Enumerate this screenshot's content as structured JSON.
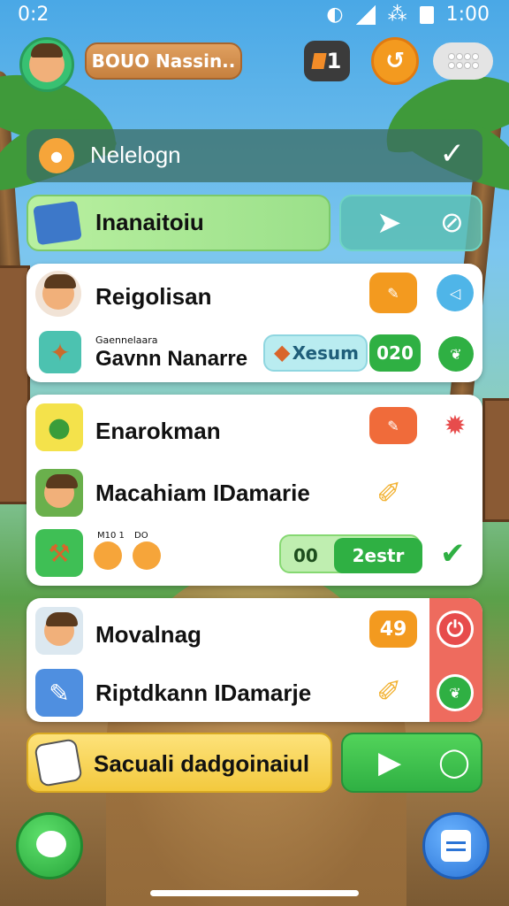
{
  "status_bar": {
    "time": "0:2",
    "clock": "1:00"
  },
  "top_bar": {
    "player_name": "BOUO Nassin..",
    "currency_value": "1"
  },
  "rows": {
    "header_row": {
      "label": "Nelelogn"
    },
    "inventory_row": {
      "label": "Inanaitoiu"
    }
  },
  "card1": {
    "item1": {
      "label": "Reigolisan"
    },
    "item2": {
      "sub_label": "Gaennelaara",
      "label": "Gavnn Nanarre",
      "pill_text": "Xesum",
      "pill_count": "020"
    }
  },
  "card2": {
    "item1": {
      "label": "Enarokman"
    },
    "item2": {
      "label": "Macahiam IDamarie"
    },
    "item3": {
      "tiny_label_a": "M10 1",
      "tiny_label_b": "DO",
      "pill_count": "00",
      "pill_text": "2estr"
    }
  },
  "card3": {
    "item1": {
      "label": "Movalnag",
      "badge": "49"
    },
    "item2": {
      "label": "Riptdkann IDamarje"
    }
  },
  "bottom_bar": {
    "label": "Sacuali dadgoinaiul"
  },
  "colors": {
    "orange": "#f39a1f",
    "green": "#2fb043",
    "blue": "#2b74d6",
    "red": "#e74c4c"
  }
}
